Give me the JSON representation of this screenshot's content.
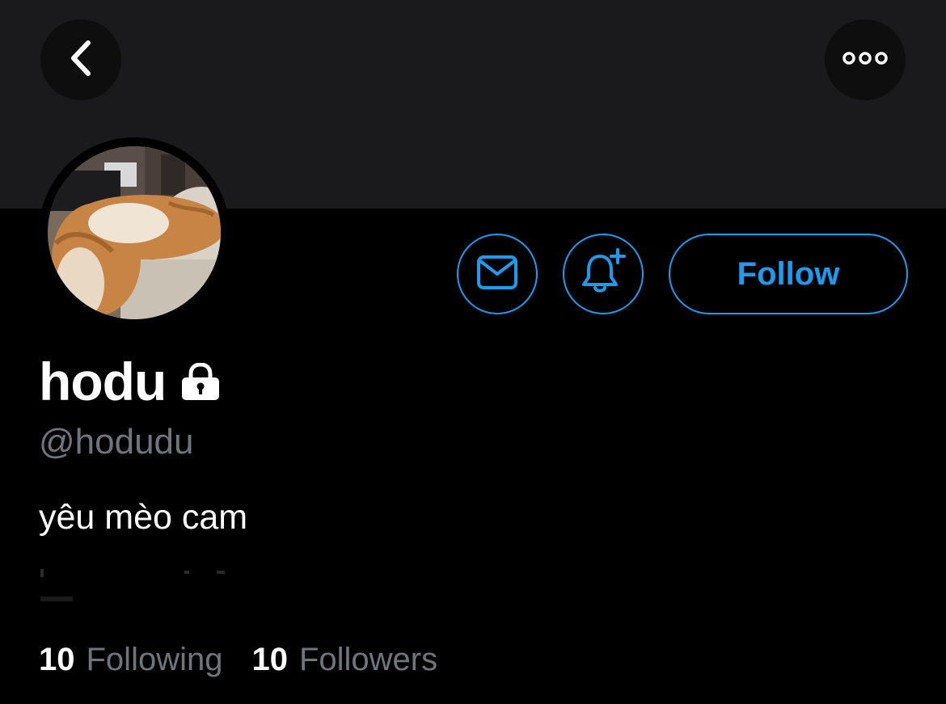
{
  "header": {
    "back_icon": "chevron-left-icon",
    "more_icon": "more-horizontal-icon"
  },
  "profile": {
    "display_name": "hodu",
    "handle": "@hodudu",
    "bio": "yêu mèo cam",
    "protected_icon": "lock-icon",
    "avatar_desc": "avatar photo"
  },
  "actions": {
    "message_icon": "envelope-icon",
    "notify_icon": "bell-plus-icon",
    "follow_label": "Follow"
  },
  "stats": {
    "following_count": "10",
    "following_label": "Following",
    "followers_count": "10",
    "followers_label": "Followers"
  },
  "colors": {
    "accent": "#1d9bf0",
    "background": "#000000",
    "banner": "#1a1a1c",
    "secondary_text": "#6e767d"
  }
}
